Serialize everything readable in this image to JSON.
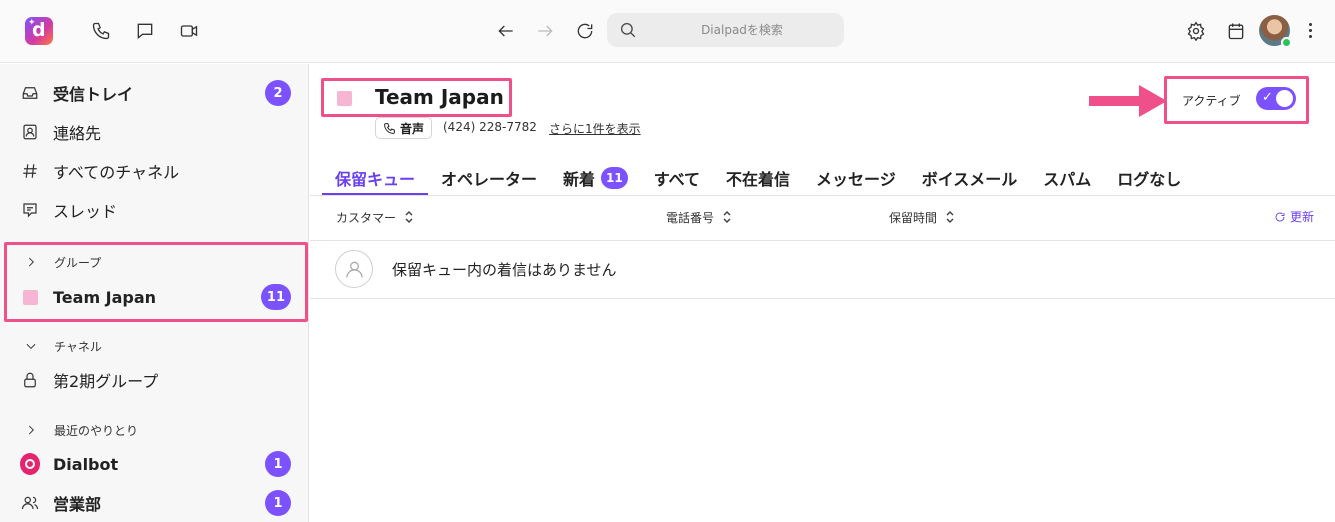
{
  "topbar": {
    "search_placeholder": "Dialpadを検索",
    "icons": [
      "phone-icon",
      "chat-icon",
      "video-icon",
      "back-arrow-icon",
      "forward-arrow-icon",
      "reload-icon",
      "search-icon",
      "gear-icon",
      "calendar-icon",
      "kebab-menu-icon"
    ]
  },
  "sidebar": {
    "items": [
      {
        "label": "受信トレイ",
        "icon": "inbox-icon",
        "badge": "2"
      },
      {
        "label": "連絡先",
        "icon": "contacts-icon"
      },
      {
        "label": "すべてのチャネル",
        "icon": "hash-icon"
      },
      {
        "label": "スレッド",
        "icon": "threads-icon"
      }
    ],
    "groups": {
      "header": "グループ",
      "items": [
        {
          "label": "Team Japan",
          "badge": "11"
        }
      ]
    },
    "channels": {
      "header": "チャネル",
      "items": [
        {
          "label": "第2期グループ",
          "icon": "lock-icon"
        }
      ]
    },
    "recent": {
      "header": "最近のやりとり",
      "items": [
        {
          "label": "Dialbot",
          "badge": "1"
        },
        {
          "label": "営業部",
          "badge": "1"
        }
      ]
    }
  },
  "main": {
    "title": "Team Japan",
    "voice_chip": "音声",
    "phone_number": "(424) 228-7782",
    "more_link": "さらに1件を表示",
    "active_label": "アクティブ",
    "active_toggle_on": true,
    "tabs": [
      {
        "label": "保留キュー",
        "active": true
      },
      {
        "label": "オペレーター"
      },
      {
        "label": "新着",
        "badge": "11"
      },
      {
        "label": "すべて"
      },
      {
        "label": "不在着信"
      },
      {
        "label": "メッセージ"
      },
      {
        "label": "ボイスメール"
      },
      {
        "label": "スパム"
      },
      {
        "label": "ログなし"
      }
    ],
    "columns": [
      "カスタマー",
      "電話番号",
      "保留時間"
    ],
    "refresh_label": "更新",
    "empty_message": "保留キュー内の着信はありません"
  },
  "colors": {
    "accent": "#7c52ff",
    "highlight": "#f0508a",
    "group_color": "#f6b6d3",
    "dialbot": "#e6246e"
  }
}
